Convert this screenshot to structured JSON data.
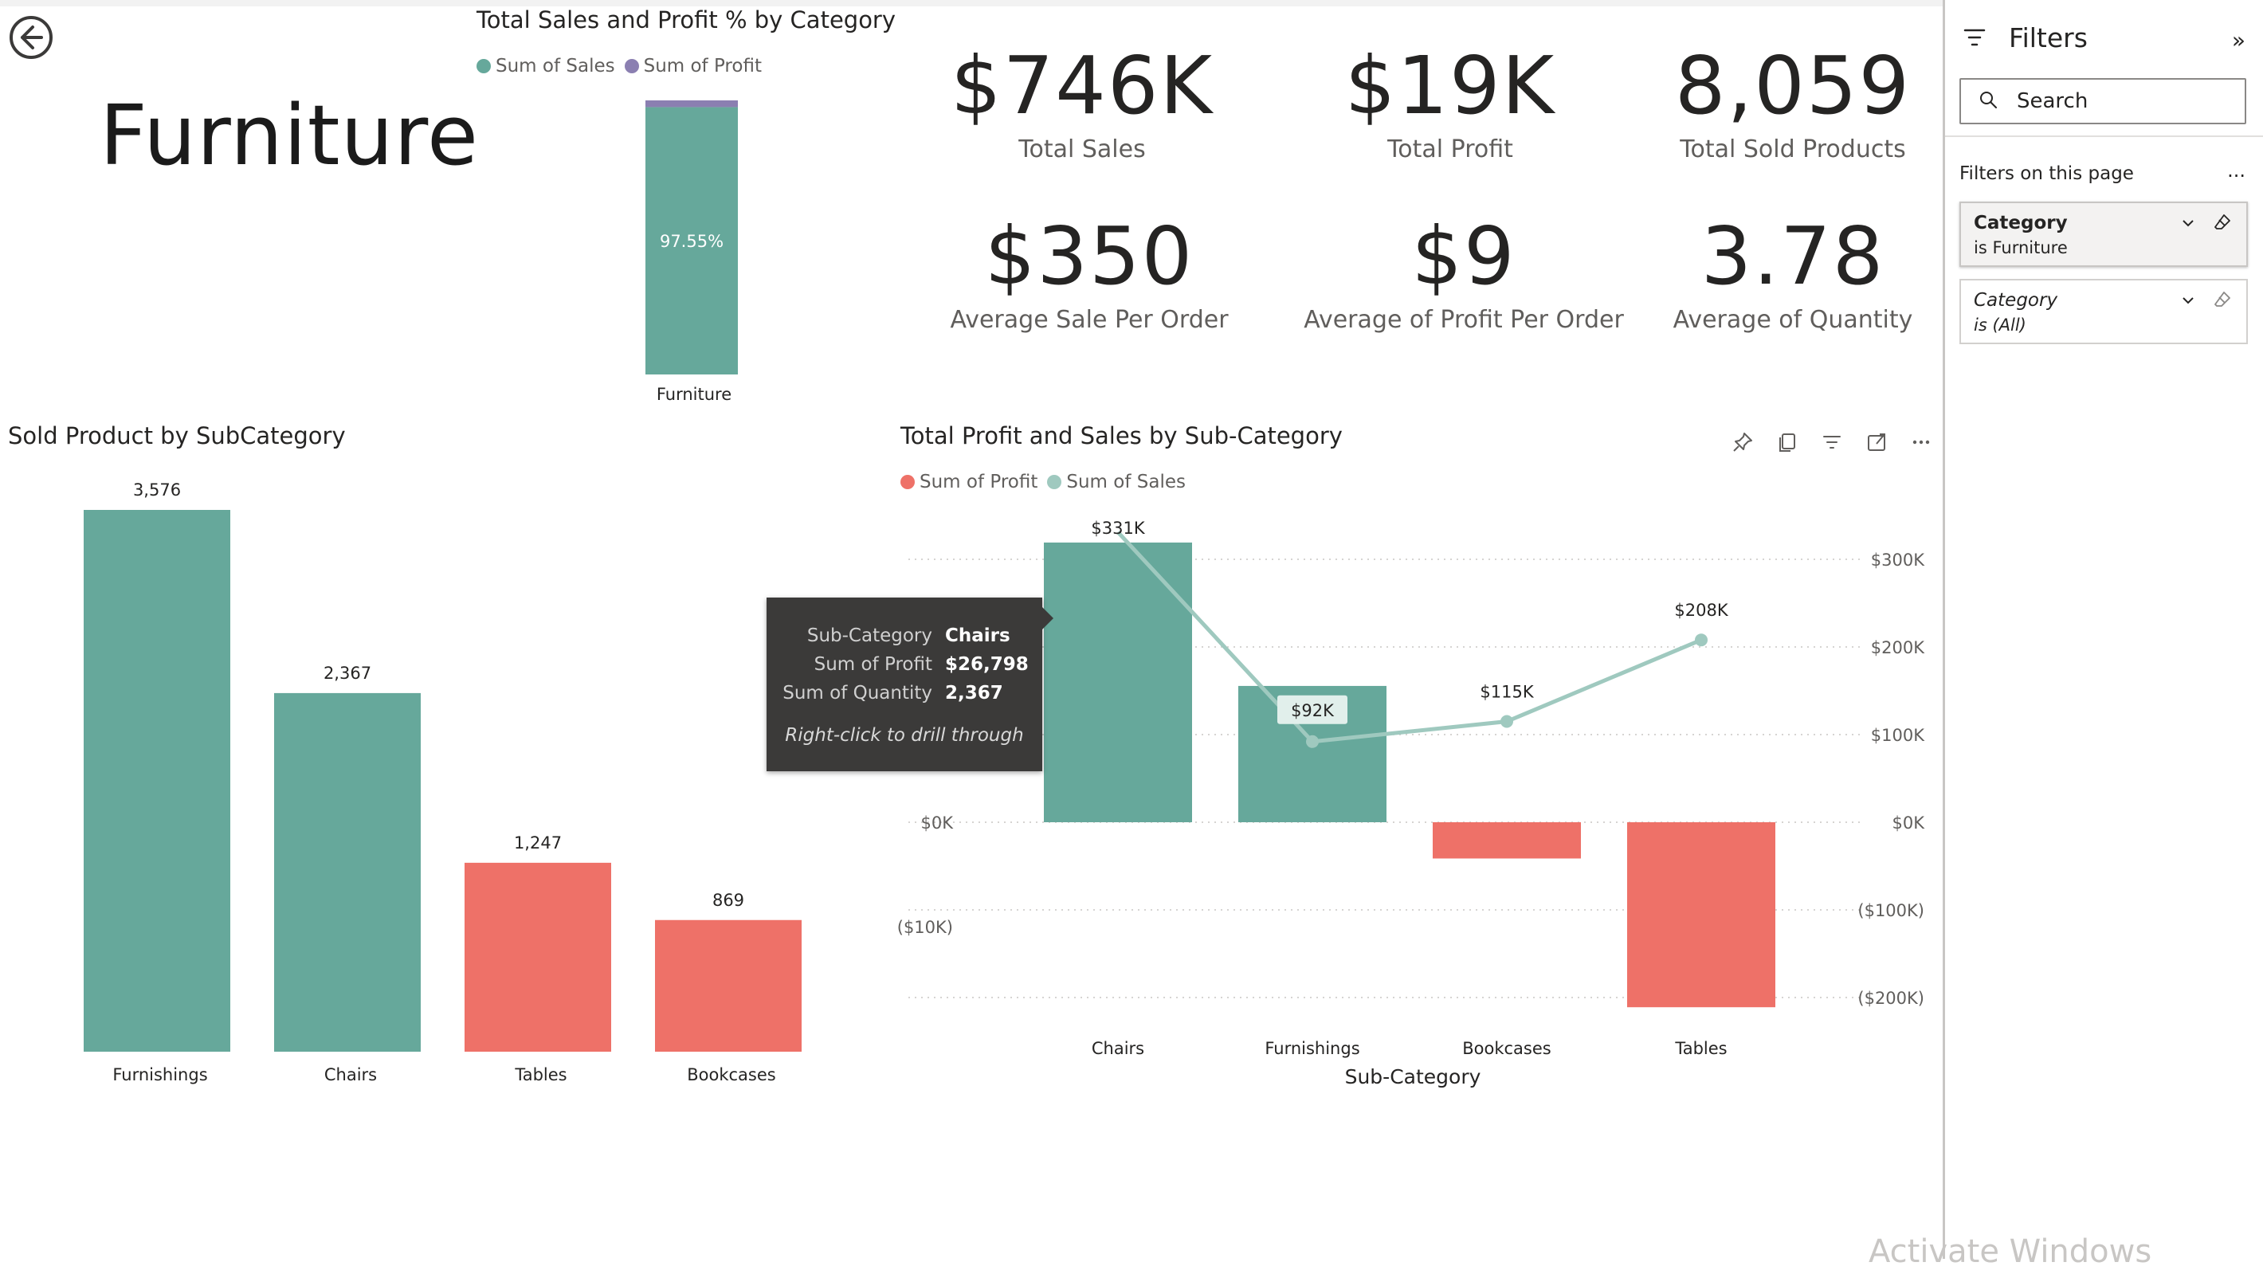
{
  "page": {
    "title": "Furniture",
    "back_button_label": "Back"
  },
  "colors": {
    "teal": "#66a89b",
    "red": "#ee7168",
    "purple": "#8b7fb1",
    "line": "#9fc9bf"
  },
  "category_visual": {
    "title": "Total Sales and Profit % by Category",
    "legend": [
      "Sum of Sales",
      "Sum of Profit"
    ]
  },
  "kpis": [
    {
      "value": "$746K",
      "label": "Total Sales"
    },
    {
      "value": "$19K",
      "label": "Total Profit"
    },
    {
      "value": "8,059",
      "label": "Total Sold Products"
    },
    {
      "value": "$350",
      "label": "Average Sale Per Order"
    },
    {
      "value": "$9",
      "label": "Average of Profit Per Order"
    },
    {
      "value": "3.78",
      "label": "Average of Quantity"
    }
  ],
  "subcategory_visual": {
    "title": "Sold Product by SubCategory"
  },
  "combo_visual": {
    "title": "Total Profit and Sales by Sub-Category",
    "legend": [
      "Sum of Profit",
      "Sum of Sales"
    ],
    "header_icons": [
      "pin-icon",
      "copy-icon",
      "filter-icon",
      "focus-mode-icon",
      "more-options-icon"
    ]
  },
  "tooltip": {
    "rows": [
      {
        "key": "Sub-Category",
        "value": "Chairs"
      },
      {
        "key": "Sum of Profit",
        "value": "$26,798"
      },
      {
        "key": "Sum of Quantity",
        "value": "2,367"
      }
    ],
    "hint": "Right-click to drill through"
  },
  "filters_pane": {
    "title": "Filters",
    "search_placeholder": "Search",
    "section_label": "Filters on this page",
    "more_label": "...",
    "cards": [
      {
        "name": "Category",
        "value": "is Furniture"
      },
      {
        "name": "Category",
        "value": "is (All)"
      }
    ]
  },
  "watermark": "Activate Windows",
  "chart_data": [
    {
      "type": "bar",
      "title": "Total Sales and Profit % by Category",
      "categories": [
        "Furniture"
      ],
      "series": [
        {
          "name": "Sum of Sales",
          "values": [
            97.55
          ]
        },
        {
          "name": "Sum of Profit",
          "values": [
            2.45
          ]
        }
      ],
      "data_labels": [
        "97.55%"
      ],
      "stacked": true,
      "ylim": [
        0,
        100
      ],
      "legend": "top-left"
    },
    {
      "type": "bar",
      "title": "Sold Product by SubCategory",
      "categories": [
        "Furnishings",
        "Chairs",
        "Tables",
        "Bookcases"
      ],
      "values": [
        3576,
        2367,
        1247,
        869
      ],
      "data_labels": [
        "3,576",
        "2,367",
        "1,247",
        "869"
      ],
      "bar_colors": [
        "#66a89b",
        "#66a89b",
        "#ee7168",
        "#ee7168"
      ],
      "ylim": [
        0,
        3576
      ]
    },
    {
      "type": "bar",
      "title": "Total Profit and Sales by Sub-Category",
      "xlabel": "Sub-Category",
      "categories": [
        "Chairs",
        "Furnishings",
        "Bookcases",
        "Tables"
      ],
      "series": [
        {
          "name": "Sum of Profit",
          "kind": "bar",
          "values": [
            26798,
            13059,
            -3473,
            -17725
          ],
          "colors": [
            "#66a89b",
            "#66a89b",
            "#ee7168",
            "#ee7168"
          ]
        },
        {
          "name": "Sum of Sales",
          "kind": "line",
          "values": [
            331000,
            92000,
            115000,
            208000
          ],
          "data_labels": [
            "$331K",
            "$92K",
            "$115K",
            "$208K"
          ]
        }
      ],
      "left_axis": {
        "ticks": [
          0,
          -10000
        ],
        "tick_labels": [
          "$0K",
          "($10K)"
        ],
        "range": [
          -17725,
          26798
        ]
      },
      "right_axis": {
        "ticks": [
          300000,
          200000,
          100000,
          0,
          -100000,
          -200000
        ],
        "tick_labels": [
          "$300K",
          "$200K",
          "$100K",
          "$0K",
          "($100K)",
          "($200K)"
        ],
        "range": [
          -200000,
          300000
        ]
      },
      "grid": true,
      "legend": "top-left"
    }
  ]
}
